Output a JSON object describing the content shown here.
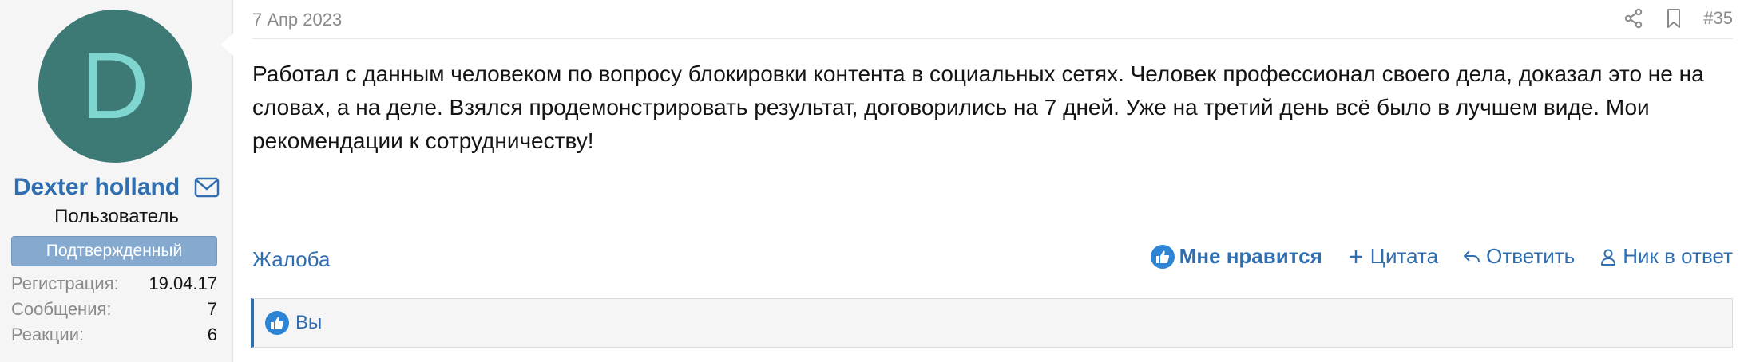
{
  "user": {
    "avatar_letter": "D",
    "avatar_bg": "#3d7a76",
    "avatar_fg": "#7fd6d0",
    "name": "Dexter holland",
    "title": "Пользователь",
    "banner": "Подтвержденный",
    "stats": [
      {
        "label": "Регистрация:",
        "value": "19.04.17"
      },
      {
        "label": "Сообщения:",
        "value": "7"
      },
      {
        "label": "Реакции:",
        "value": "6"
      }
    ]
  },
  "post": {
    "date": "7 Апр 2023",
    "number": "#35",
    "body": "Работал с данным человеком по вопросу блокировки контента в социальных сетях. Человек профессионал своего дела, доказал это не на словах, а на деле. Взялся продемонстрировать результат, договорились на 7 дней. Уже на третий день всё было в лучшем виде. Мои рекомендации к сотрудничеству!"
  },
  "footer": {
    "report": "Жалоба",
    "like": "Мне нравится",
    "quote": "Цитата",
    "reply": "Ответить",
    "nick": "Ник в ответ"
  },
  "reactions": {
    "text": "Вы"
  },
  "colors": {
    "link": "#2f6eb0",
    "like_badge": "#2d84d4",
    "banner": "#86a9cf"
  },
  "icons": [
    "mail-icon",
    "share-icon",
    "bookmark-icon",
    "thumbs-up-icon",
    "plus-icon",
    "reply-icon",
    "person-icon"
  ]
}
